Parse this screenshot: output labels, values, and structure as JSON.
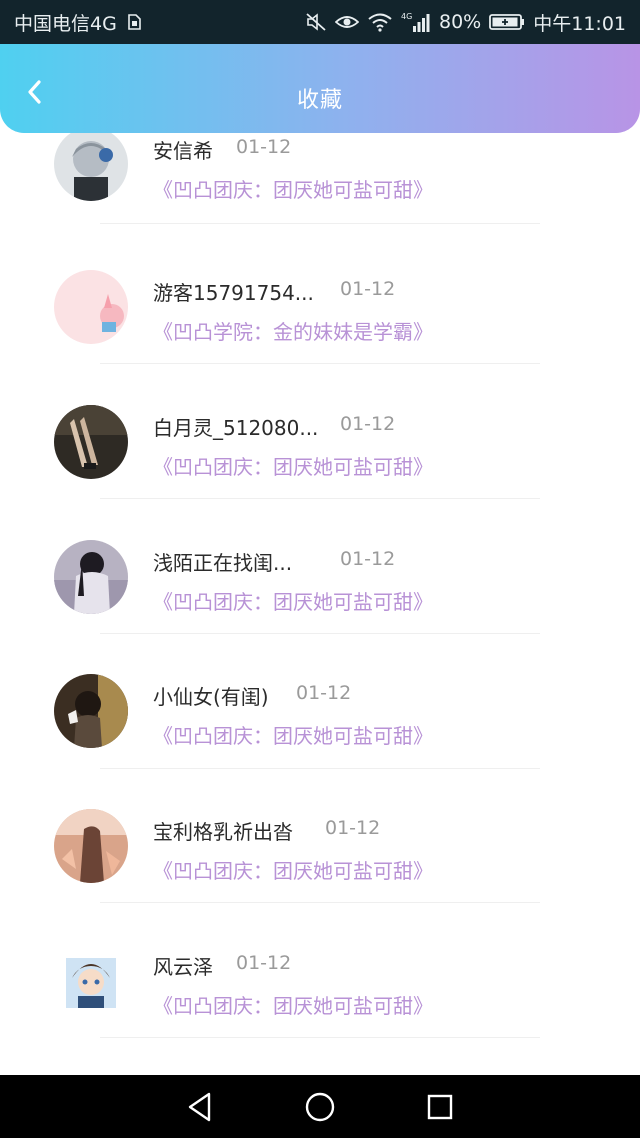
{
  "status_bar": {
    "carrier": "中国电信4G",
    "network_tag": "4G",
    "battery": "80%",
    "time": "中午11:01",
    "icons": [
      "sim-icon",
      "mute-icon",
      "eye-icon",
      "wifi-icon",
      "signal-icon",
      "battery-icon"
    ]
  },
  "header": {
    "title": "收藏",
    "back_icon": "back-chevron-icon"
  },
  "items": [
    {
      "name": "安信希",
      "date": "01-12",
      "work": "《凹凸团庆：团厌她可盐可甜》",
      "avatar": "avatar-1"
    },
    {
      "name": "游客15791754...",
      "date": "01-12",
      "work": "《凹凸学院：金的妹妹是学霸》",
      "avatar": "avatar-2"
    },
    {
      "name": "白月灵_512080...",
      "date": "01-12",
      "work": "《凹凸团庆：团厌她可盐可甜》",
      "avatar": "avatar-3"
    },
    {
      "name": "浅陌正在找闺...",
      "date": "01-12",
      "work": "《凹凸团庆：团厌她可盐可甜》",
      "avatar": "avatar-4"
    },
    {
      "name": "小仙女(有闺)",
      "date": "01-12",
      "work": "《凹凸团庆：团厌她可盐可甜》",
      "avatar": "avatar-5"
    },
    {
      "name": "宝利格乳祈出沓",
      "date": "01-12",
      "work": "《凹凸团庆：团厌她可盐可甜》",
      "avatar": "avatar-6"
    },
    {
      "name": "风云泽",
      "date": "01-12",
      "work": "《凹凸团庆：团厌她可盐可甜》",
      "avatar": "avatar-7"
    }
  ],
  "nav_bar": {
    "icons": [
      "back-triangle-icon",
      "home-circle-icon",
      "recents-square-icon"
    ]
  },
  "colors": {
    "header_gradient_start": "#4fd0f0",
    "header_gradient_end": "#b894e6",
    "work_link": "#b892d6",
    "date_text": "#9a9a9a",
    "status_bar_bg": "#12242c"
  }
}
